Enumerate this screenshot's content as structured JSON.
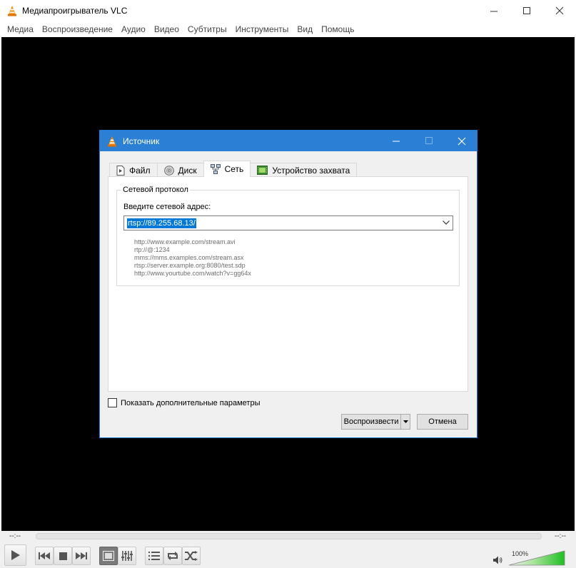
{
  "window": {
    "title": "Медиапроигрыватель VLC"
  },
  "menu": {
    "items": [
      {
        "label": "Медиа"
      },
      {
        "label": "Воспроизведение"
      },
      {
        "label": "Аудио"
      },
      {
        "label": "Видео"
      },
      {
        "label": "Субтитры"
      },
      {
        "label": "Инструменты"
      },
      {
        "label": "Вид"
      },
      {
        "label": "Помощь"
      }
    ]
  },
  "dialog": {
    "title": "Источник",
    "tabs": [
      {
        "label": "Файл",
        "icon": "file-icon"
      },
      {
        "label": "Диск",
        "icon": "disc-icon"
      },
      {
        "label": "Сеть",
        "icon": "network-icon",
        "active": true
      },
      {
        "label": "Устройство захвата",
        "icon": "capture-device-icon"
      }
    ],
    "network": {
      "group_title": "Сетевой протокол",
      "address_label": "Введите сетевой адрес:",
      "address_value": "rtsp://89.255.68.13/",
      "examples": [
        "http://www.example.com/stream.avi",
        "rtp://@:1234",
        "mms://mms.examples.com/stream.asx",
        "rtsp://server.example.org:8080/test.sdp",
        "http://www.yourtube.com/watch?v=gg64x"
      ]
    },
    "show_more_options": "Показать дополнительные параметры",
    "play_button": "Воспроизвести",
    "cancel_button": "Отмена"
  },
  "controls": {
    "time_elapsed": "--:--",
    "time_total": "--:--",
    "volume_percent": "100%",
    "volume_level": 1.0
  },
  "colors": {
    "accent": "#2b7fd5",
    "selection": "#0078d7",
    "video_background": "#000000",
    "volume_fill": "#22c22a"
  }
}
